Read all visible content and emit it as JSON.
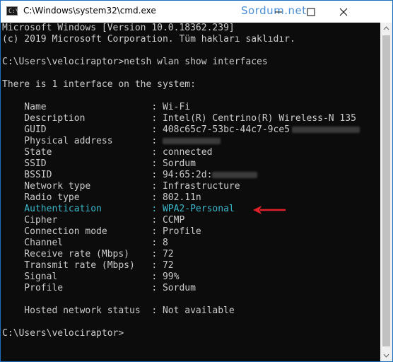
{
  "window": {
    "title": "C:\\Windows\\system32\\cmd.exe",
    "watermark": "Sordum.net",
    "app_icon_text": "C:\\",
    "accent_color": "#1f6fc0"
  },
  "console": {
    "lines": [
      "Microsoft Windows [Version 10.0.18362.239]",
      "(c) 2019 Microsoft Corporation. Tüm hakları saklıdır.",
      "",
      "C:\\Users\\velociraptor>netsh wlan show interfaces",
      "",
      "There is 1 interface on the system:",
      "",
      "    Name                   : Wi-Fi",
      "    Description            : Intel(R) Centrino(R) Wireless-N 135",
      "    GUID                   : 408c65c7-53bc-44c7-9ce5",
      "    Physical address       : ",
      "    State                  : connected",
      "    SSID                   : Sordum",
      "    BSSID                  : 94:65:2d:",
      "    Network type           : Infrastructure",
      "    Radio type             : 802.11n",
      "    Authentication         : WPA2-Personal",
      "    Cipher                 : CCMP",
      "    Connection mode        : Profile",
      "    Channel                : 8",
      "    Receive rate (Mbps)    : 72",
      "    Transmit rate (Mbps)   : 72",
      "    Signal                 : 99%",
      "    Profile                : Sordum",
      "",
      "    Hosted network status  : Not available",
      "",
      "C:\\Users\\velociraptor>"
    ],
    "text_color": "#cccccc",
    "highlight_color": "#3ab8c8",
    "background_color": "#0c0c0c"
  },
  "annotation": {
    "arrow_color": "#e0202a"
  },
  "icons": [
    "console-app-icon",
    "minimize-icon",
    "maximize-icon",
    "close-icon",
    "scroll-up-icon",
    "scroll-down-icon",
    "red-arrow-icon"
  ]
}
